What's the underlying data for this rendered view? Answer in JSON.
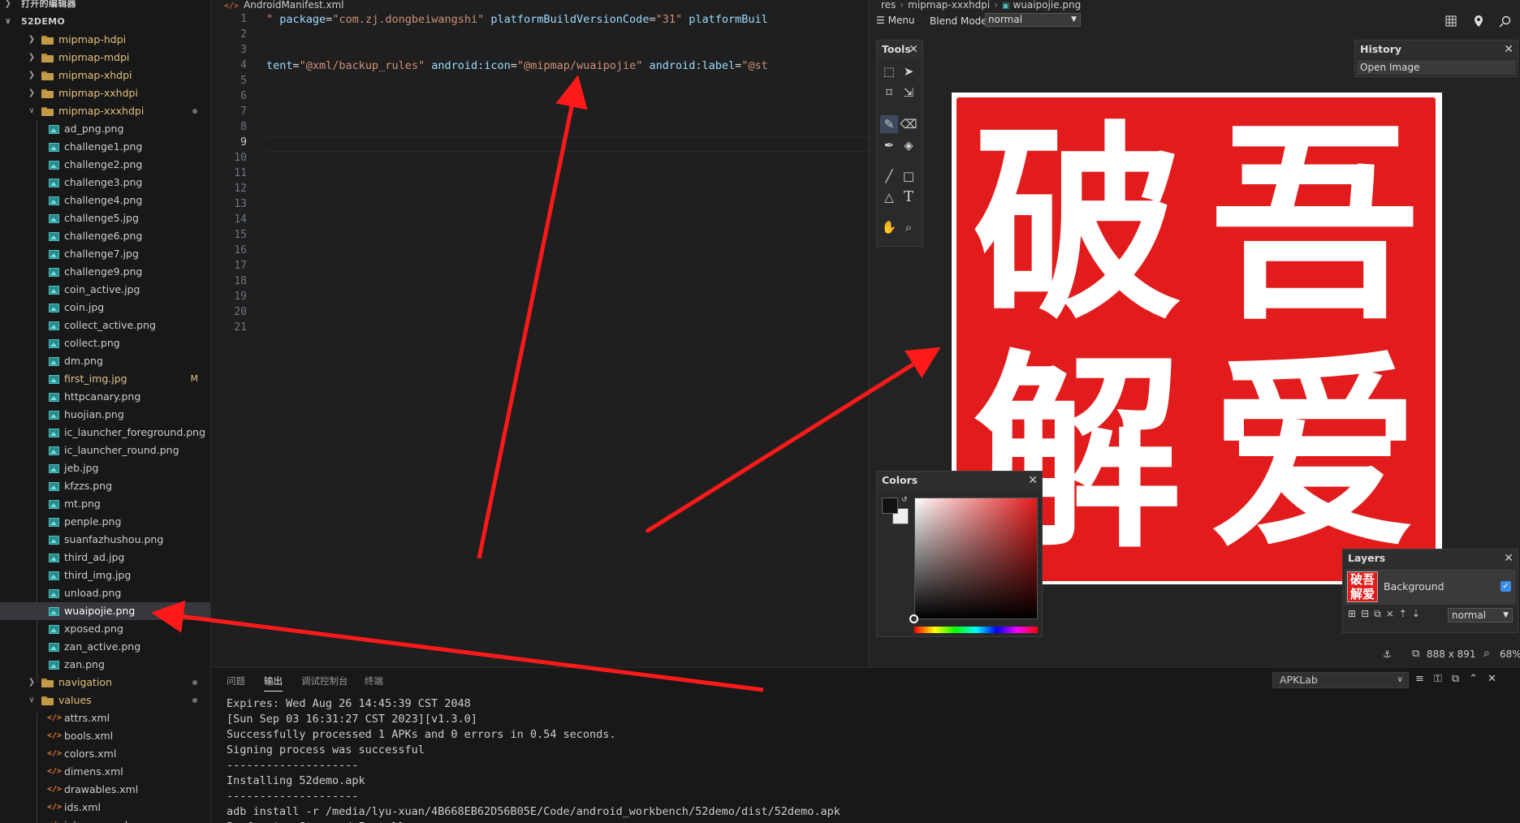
{
  "explorer": {
    "open_editors_label": "打开的编辑器",
    "project_label": "52DEMO",
    "rows": [
      {
        "kind": "folder-closed",
        "depth": 1,
        "name": "mipmap-hdpi"
      },
      {
        "kind": "folder-closed",
        "depth": 1,
        "name": "mipmap-mdpi"
      },
      {
        "kind": "folder-closed",
        "depth": 1,
        "name": "mipmap-xhdpi"
      },
      {
        "kind": "folder-closed",
        "depth": 1,
        "name": "mipmap-xxhdpi"
      },
      {
        "kind": "folder-open",
        "depth": 1,
        "name": "mipmap-xxxhdpi",
        "badge": "dot"
      },
      {
        "kind": "image",
        "depth": 2,
        "name": "ad_png.png"
      },
      {
        "kind": "image",
        "depth": 2,
        "name": "challenge1.png"
      },
      {
        "kind": "image",
        "depth": 2,
        "name": "challenge2.png"
      },
      {
        "kind": "image",
        "depth": 2,
        "name": "challenge3.png"
      },
      {
        "kind": "image",
        "depth": 2,
        "name": "challenge4.png"
      },
      {
        "kind": "image",
        "depth": 2,
        "name": "challenge5.jpg"
      },
      {
        "kind": "image",
        "depth": 2,
        "name": "challenge6.png"
      },
      {
        "kind": "image",
        "depth": 2,
        "name": "challenge7.jpg"
      },
      {
        "kind": "image",
        "depth": 2,
        "name": "challenge9.png"
      },
      {
        "kind": "image",
        "depth": 2,
        "name": "coin_active.jpg"
      },
      {
        "kind": "image",
        "depth": 2,
        "name": "coin.jpg"
      },
      {
        "kind": "image",
        "depth": 2,
        "name": "collect_active.png"
      },
      {
        "kind": "image",
        "depth": 2,
        "name": "collect.png"
      },
      {
        "kind": "image",
        "depth": 2,
        "name": "dm.png"
      },
      {
        "kind": "image",
        "depth": 2,
        "name": "first_img.jpg",
        "badge": "M",
        "modified": true
      },
      {
        "kind": "image",
        "depth": 2,
        "name": "httpcanary.png"
      },
      {
        "kind": "image",
        "depth": 2,
        "name": "huojian.png"
      },
      {
        "kind": "image",
        "depth": 2,
        "name": "ic_launcher_foreground.png"
      },
      {
        "kind": "image",
        "depth": 2,
        "name": "ic_launcher_round.png"
      },
      {
        "kind": "image",
        "depth": 2,
        "name": "jeb.jpg"
      },
      {
        "kind": "image",
        "depth": 2,
        "name": "kfzzs.png"
      },
      {
        "kind": "image",
        "depth": 2,
        "name": "mt.png"
      },
      {
        "kind": "image",
        "depth": 2,
        "name": "penple.png"
      },
      {
        "kind": "image",
        "depth": 2,
        "name": "suanfazhushou.png"
      },
      {
        "kind": "image",
        "depth": 2,
        "name": "third_ad.jpg"
      },
      {
        "kind": "image",
        "depth": 2,
        "name": "third_img.jpg"
      },
      {
        "kind": "image",
        "depth": 2,
        "name": "unload.png"
      },
      {
        "kind": "image",
        "depth": 2,
        "name": "wuaipojie.png",
        "selected": true
      },
      {
        "kind": "image",
        "depth": 2,
        "name": "xposed.png"
      },
      {
        "kind": "image",
        "depth": 2,
        "name": "zan_active.png"
      },
      {
        "kind": "image",
        "depth": 2,
        "name": "zan.png"
      },
      {
        "kind": "folder-closed",
        "depth": 1,
        "name": "navigation",
        "badge": "dot"
      },
      {
        "kind": "folder-open",
        "depth": 1,
        "name": "values",
        "badge": "dot"
      },
      {
        "kind": "xml",
        "depth": 2,
        "name": "attrs.xml"
      },
      {
        "kind": "xml",
        "depth": 2,
        "name": "bools.xml"
      },
      {
        "kind": "xml",
        "depth": 2,
        "name": "colors.xml"
      },
      {
        "kind": "xml",
        "depth": 2,
        "name": "dimens.xml"
      },
      {
        "kind": "xml",
        "depth": 2,
        "name": "drawables.xml"
      },
      {
        "kind": "xml",
        "depth": 2,
        "name": "ids.xml"
      },
      {
        "kind": "xml",
        "depth": 2,
        "name": "integers.xml"
      }
    ]
  },
  "editor": {
    "tab_title": "AndroidManifest.xml",
    "current_line": 9,
    "line_numbers": [
      "1",
      "2",
      "3",
      "4",
      "5",
      "6",
      "7",
      "8",
      "9",
      "10",
      "11",
      "12",
      "13",
      "14",
      "15",
      "16",
      "17",
      "18",
      "19",
      "20",
      "21"
    ],
    "line1": [
      {
        "t": "\" ",
        "c": "str"
      },
      {
        "t": "package",
        "c": "attr"
      },
      {
        "t": "=",
        "c": "eq"
      },
      {
        "t": "\"com.zj.dongbeiwangshi\"",
        "c": "str"
      },
      {
        "t": " platformBuildVersionCode",
        "c": "attr"
      },
      {
        "t": "=",
        "c": "eq"
      },
      {
        "t": "\"31\"",
        "c": "str"
      },
      {
        "t": " platformBuil",
        "c": "attr"
      }
    ],
    "line4": [
      {
        "t": "tent",
        "c": "attr"
      },
      {
        "t": "=",
        "c": "eq"
      },
      {
        "t": "\"@xml/backup_rules\"",
        "c": "str"
      },
      {
        "t": " android:icon",
        "c": "attr"
      },
      {
        "t": "=",
        "c": "eq"
      },
      {
        "t": "\"@mipmap/wuaipojie\"",
        "c": "str"
      },
      {
        "t": " android:label",
        "c": "attr"
      },
      {
        "t": "=",
        "c": "eq"
      },
      {
        "t": "\"@st",
        "c": "str"
      }
    ]
  },
  "paint": {
    "breadcrumb": [
      "res",
      "mipmap-xxxhdpi",
      "wuaipojie.png"
    ],
    "menu_label": "Menu",
    "blend_label": "Blend Mode:",
    "blend_value": "normal",
    "tools_title": "Tools",
    "history_title": "History",
    "history_items": [
      "Open Image"
    ],
    "colors_title": "Colors",
    "layers_title": "Layers",
    "layer_name": "Background",
    "layer_blend": "normal",
    "image_size": "888 x 891",
    "zoom": "68%",
    "seal_chars": [
      "破",
      "吾",
      "解",
      "爱"
    ],
    "seal_color": "#e21c1c"
  },
  "bottom": {
    "tabs": [
      "问题",
      "输出",
      "调试控制台",
      "终端"
    ],
    "active_tab": "输出",
    "output_channel": "APKLab",
    "output_lines": [
      "Expires: Wed Aug 26 14:45:39 CST 2048",
      "[Sun Sep 03 16:31:27 CST 2023][v1.3.0]",
      "Successfully processed 1 APKs and 0 errors in 0.54 seconds.",
      "Signing process was successful",
      "--------------------",
      "Installing 52demo.apk",
      "--------------------",
      "adb install -r /media/lyu-xuan/4B668EB62D56B05E/Code/android_workbench/52demo/dist/52demo.apk",
      "Performing Streamed Install"
    ]
  },
  "annotation_color": "#ff1a1a"
}
